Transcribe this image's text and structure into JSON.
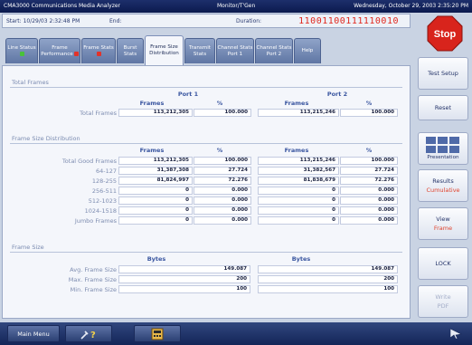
{
  "title_bar": {
    "app_name": "CMA3000 Communications Media Analyzer",
    "mode": "Monitor/T'Gen",
    "datetime": "Wednesday, October 29, 2003 2:35:20 PM"
  },
  "info_bar": {
    "start_label": "Start: 10/29/03 2:32:48 PM",
    "end_label": "End:",
    "duration_label": "Duration:",
    "bit_pattern": "11001100111110010"
  },
  "tabs": [
    {
      "label": "Line Status",
      "indicator": "green"
    },
    {
      "label": "Frame Performance",
      "indicator": "red"
    },
    {
      "label": "Frame Stats",
      "indicator": "red"
    },
    {
      "label": "Burst Stats",
      "indicator": ""
    },
    {
      "label": "Frame Size Distribution",
      "indicator": "",
      "active": true
    },
    {
      "label": "Transmit Stats",
      "indicator": ""
    },
    {
      "label": "Channel Stats Port 1",
      "indicator": ""
    },
    {
      "label": "Channel Stats Port 2",
      "indicator": ""
    },
    {
      "label": "Help",
      "indicator": ""
    }
  ],
  "total_frames": {
    "section_title": "Total Frames",
    "port1_label": "Port 1",
    "port2_label": "Port 2",
    "col_frames": "Frames",
    "col_percent": "%",
    "row_label": "Total Frames",
    "port1_frames": "113,212,305",
    "port1_percent": "100.000",
    "port2_frames": "113,215,246",
    "port2_percent": "100.000"
  },
  "distribution": {
    "section_title": "Frame Size Distribution",
    "col_frames": "Frames",
    "col_percent": "%",
    "rows": [
      {
        "label": "Total Good Frames",
        "p1_frames": "113,212,305",
        "p1_pct": "100.000",
        "p2_frames": "113,215,246",
        "p2_pct": "100.000"
      },
      {
        "label": "64-127",
        "p1_frames": "31,387,308",
        "p1_pct": "27.724",
        "p2_frames": "31,382,567",
        "p2_pct": "27.724"
      },
      {
        "label": "128-255",
        "p1_frames": "81,824,997",
        "p1_pct": "72.276",
        "p2_frames": "81,838,679",
        "p2_pct": "72.276"
      },
      {
        "label": "256-511",
        "p1_frames": "0",
        "p1_pct": "0.000",
        "p2_frames": "0",
        "p2_pct": "0.000"
      },
      {
        "label": "512-1023",
        "p1_frames": "0",
        "p1_pct": "0.000",
        "p2_frames": "0",
        "p2_pct": "0.000"
      },
      {
        "label": "1024-1518",
        "p1_frames": "0",
        "p1_pct": "0.000",
        "p2_frames": "0",
        "p2_pct": "0.000"
      },
      {
        "label": "Jumbo Frames",
        "p1_frames": "0",
        "p1_pct": "0.000",
        "p2_frames": "0",
        "p2_pct": "0.000"
      }
    ]
  },
  "frame_size": {
    "section_title": "Frame Size",
    "col_bytes": "Bytes",
    "rows": [
      {
        "label": "Avg. Frame Size",
        "p1": "149.087",
        "p2": "149.087"
      },
      {
        "label": "Max. Frame Size",
        "p1": "200",
        "p2": "200"
      },
      {
        "label": "Min. Frame Size",
        "p1": "100",
        "p2": "100"
      }
    ]
  },
  "sidebar": {
    "stop_label": "Stop",
    "test_setup": "Test Setup",
    "reset": "Reset",
    "presentation": "Presentation",
    "results": "Results",
    "results_sub": "Cumulative",
    "view": "View",
    "view_sub": "Frame",
    "lock": "LOCK",
    "write": "Write",
    "write_sub": "PDF"
  },
  "bottom_bar": {
    "main_menu": "Main Menu"
  },
  "colors": {
    "stop_red": "#d8241c",
    "accent_orange": "#e0442e",
    "bit_pattern_red": "#e0281e"
  }
}
